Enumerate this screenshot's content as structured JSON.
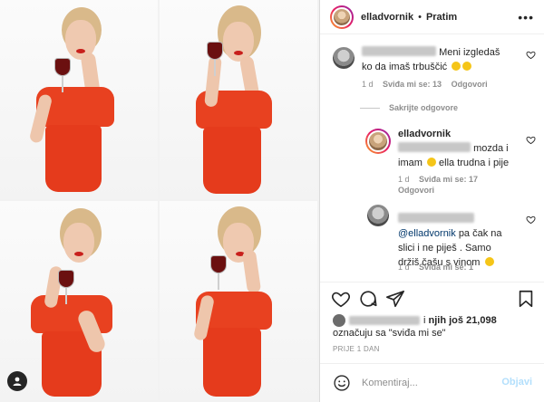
{
  "post": {
    "username": "elladvornik",
    "separator": "•",
    "follow_label": "Pratim",
    "more_label": "•••"
  },
  "comments": [
    {
      "text": "Meni izgledaš ko da imaš trbuščić",
      "time": "1 d",
      "likes": "Sviđa mi se: 13",
      "reply": "Odgovori"
    },
    {
      "username": "elladvornik",
      "text_a": "mozda i imam",
      "text_b": "ella trudna i pije",
      "time": "1 d",
      "likes": "Sviđa mi se: 17",
      "reply": "Odgovori"
    },
    {
      "mention": "@elladvornik",
      "text": "pa čak na slici i ne piješ . Samo držiš čašu s vinom",
      "time": "1 d",
      "likes": "Sviđa mi se: 1"
    }
  ],
  "hide_replies": "Sakrijte odgovore",
  "likes_line": {
    "prefix": "i",
    "others": "njih još 21,098",
    "suffix": "označuju sa \"sviđa mi se\""
  },
  "time_ago": "PRIJE 1 DAN",
  "comment_box": {
    "placeholder": "Komentiraj...",
    "post_label": "Objavi"
  },
  "colors": {
    "accent_link": "#00376b",
    "post_disabled": "#b2dffc",
    "dress": "#e84120"
  },
  "icons": [
    "heart-icon",
    "comment-icon",
    "share-icon",
    "bookmark-icon",
    "smiley-icon",
    "user-tag-icon",
    "more-icon"
  ]
}
